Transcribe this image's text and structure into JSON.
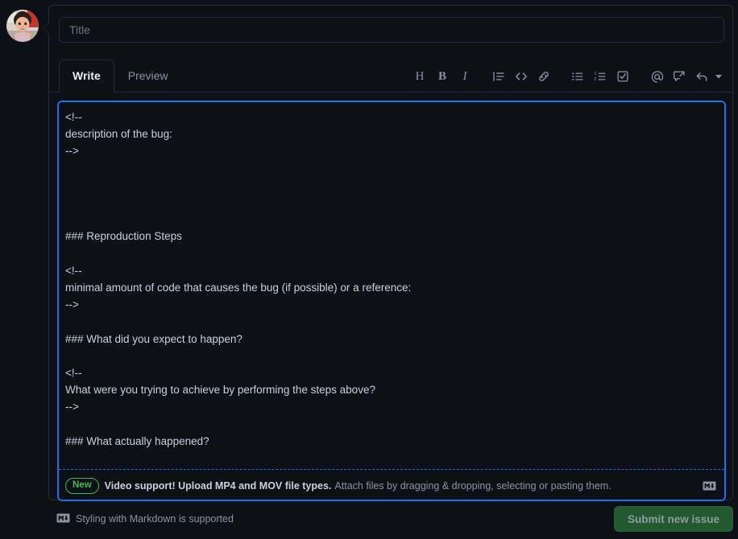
{
  "avatar": {
    "alt": "user-avatar"
  },
  "title_field": {
    "placeholder": "Title",
    "value": ""
  },
  "tabs": [
    {
      "label": "Write",
      "active": true
    },
    {
      "label": "Preview",
      "active": false
    }
  ],
  "toolbar": [
    {
      "name": "heading-icon",
      "glyph": "H"
    },
    {
      "name": "bold-icon",
      "glyph": "B"
    },
    {
      "name": "italic-icon",
      "glyph": "I"
    },
    {
      "name": "quote-icon",
      "glyph": ""
    },
    {
      "name": "code-icon",
      "glyph": ""
    },
    {
      "name": "link-icon",
      "glyph": ""
    },
    {
      "name": "unordered-list-icon",
      "glyph": ""
    },
    {
      "name": "ordered-list-icon",
      "glyph": ""
    },
    {
      "name": "task-list-icon",
      "glyph": ""
    },
    {
      "name": "mention-icon",
      "glyph": ""
    },
    {
      "name": "reference-icon",
      "glyph": ""
    },
    {
      "name": "saved-reply-icon",
      "glyph": ""
    }
  ],
  "editor": {
    "body": "<!--\ndescription of the bug:\n-->\n\n\n\n\n### Reproduction Steps\n\n<!--\nminimal amount of code that causes the bug (if possible) or a reference:\n-->\n\n### What did you expect to happen?\n\n<!--\nWhat were you trying to achieve by performing the steps above?\n-->\n\n### What actually happened?\n\n<!--"
  },
  "attach_note": {
    "badge": "New",
    "strong": "Video support! Upload MP4 and MOV file types.",
    "dim": "Attach files by dragging & dropping, selecting or pasting them."
  },
  "bottom": {
    "markdown_support": "Styling with Markdown is supported",
    "submit_label": "Submit new issue"
  },
  "colors": {
    "background": "#0d1117",
    "border": "#272b33",
    "focus_blue": "#1f6feb",
    "badge_green": "#3fb950",
    "submit_green": "#23592f",
    "text_primary": "#c9d1d9",
    "text_muted": "#8b949e"
  }
}
